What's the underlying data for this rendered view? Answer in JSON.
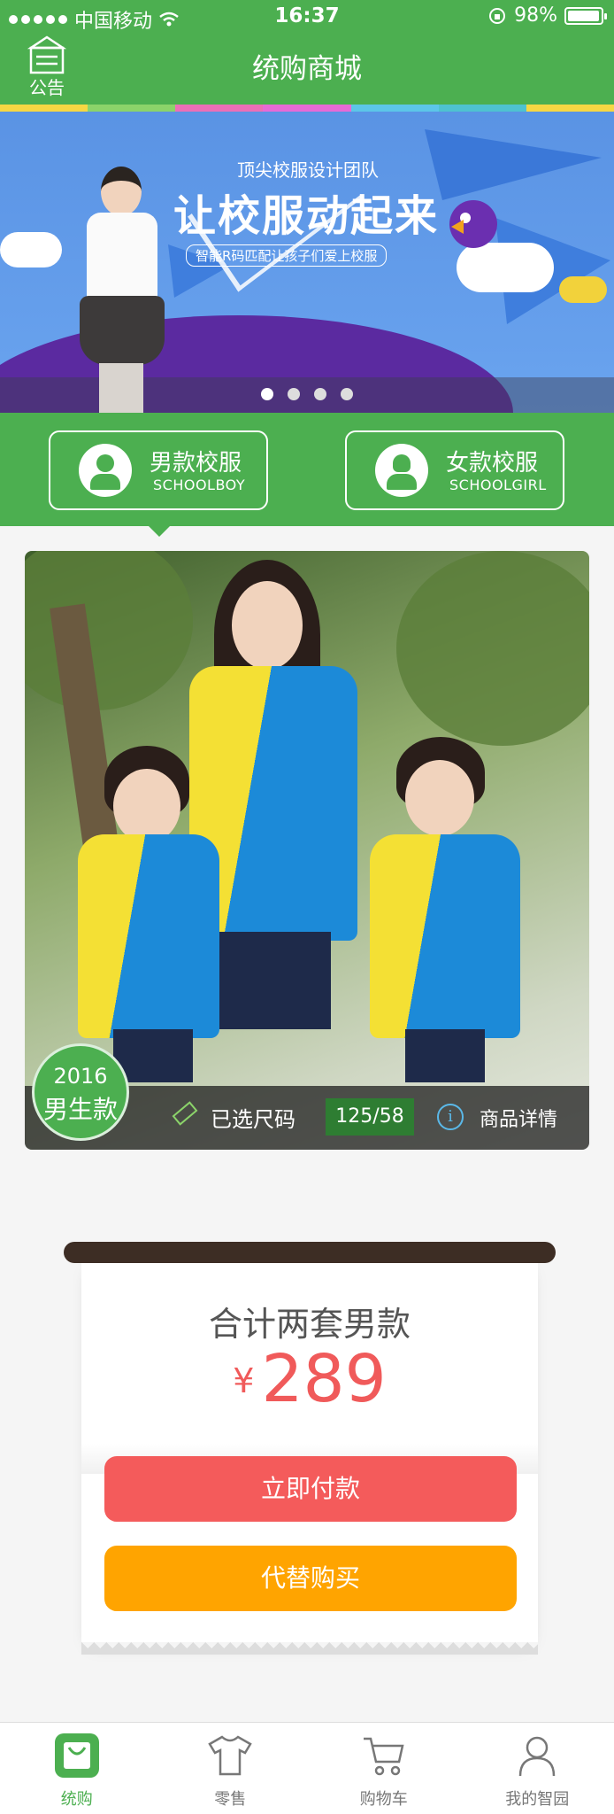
{
  "status_bar": {
    "carrier": "中国移动",
    "time": "16:37",
    "battery": "98%",
    "battery_level": 0.98
  },
  "nav": {
    "title": "统购商城",
    "notice_label": "公告"
  },
  "banner": {
    "subtitle": "顶尖校服设计团队",
    "title": "让校服动起来",
    "tagline": "智能R码匹配让孩子们爱上校服",
    "pages": 4,
    "active_page": 0
  },
  "categories": [
    {
      "title": "男款校服",
      "subtitle": "SCHOOLBOY",
      "icon": "boy-icon"
    },
    {
      "title": "女款校服",
      "subtitle": "SCHOOLGIRL",
      "icon": "girl-icon"
    }
  ],
  "product": {
    "year": "2016",
    "kind": "男生款",
    "size_label": "已选尺码",
    "size_value": "125/58",
    "detail_label": "商品详情"
  },
  "order": {
    "total_label": "合计两套男款",
    "currency": "¥",
    "price": "289",
    "pay_button": "立即付款",
    "proxy_button": "代替购买"
  },
  "tabbar": [
    {
      "label": "统购",
      "icon": "shopping-bag-icon",
      "active": true
    },
    {
      "label": "零售",
      "icon": "tshirt-icon",
      "active": false
    },
    {
      "label": "购物车",
      "icon": "cart-icon",
      "active": false
    },
    {
      "label": "我的智园",
      "icon": "user-icon",
      "active": false
    }
  ],
  "colors": {
    "primary": "#4caf50",
    "pay": "#f45b5b",
    "proxy": "#ffa400",
    "price": "#f05a5a"
  }
}
